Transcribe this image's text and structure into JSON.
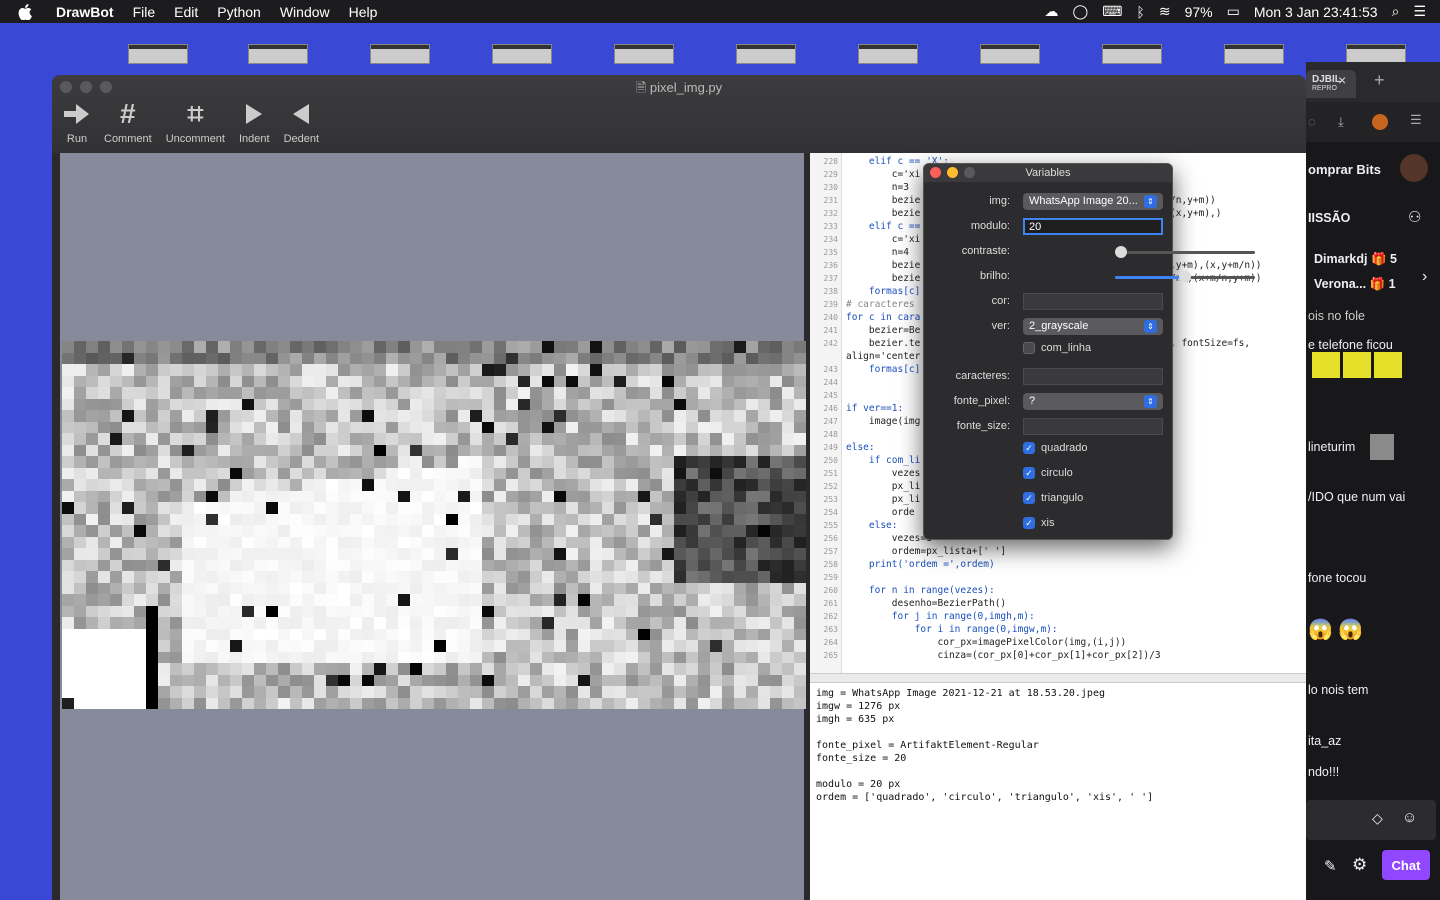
{
  "menubar": {
    "app": "DrawBot",
    "items": [
      "File",
      "Edit",
      "Python",
      "Window",
      "Help"
    ],
    "battery": "97%",
    "clock": "Mon 3 Jan  23:41:53"
  },
  "window": {
    "title": "pixel_img.py",
    "toolbar": {
      "run": "Run",
      "comment": "Comment",
      "uncomment": "Uncomment",
      "indent": "Indent",
      "dedent": "Dedent"
    }
  },
  "code": {
    "lines": [
      {
        "n": "228",
        "t": "    elif c == 'X':"
      },
      {
        "n": "229",
        "t": "        c='xi"
      },
      {
        "n": "230",
        "t": "        n=3"
      },
      {
        "n": "231",
        "t": "        bezie"
      },
      {
        "n": "232",
        "t": "        bezie"
      },
      {
        "n": "233",
        "t": "    elif c =="
      },
      {
        "n": "234",
        "t": "        c='xi"
      },
      {
        "n": "235",
        "t": "        n=4"
      },
      {
        "n": "236",
        "t": "        bezie"
      },
      {
        "n": "237",
        "t": "        bezie"
      },
      {
        "n": "238",
        "t": "    formas[c]"
      },
      {
        "n": "239",
        "t": "# caracteres"
      },
      {
        "n": "240",
        "t": "for c in cara"
      },
      {
        "n": "241",
        "t": "    bezier=Be"
      },
      {
        "n": "242",
        "t": "    bezier.te"
      },
      {
        "n": "",
        "t": "align='center"
      },
      {
        "n": "243",
        "t": "    formas[c]"
      },
      {
        "n": "244",
        "t": ""
      },
      {
        "n": "245",
        "t": ""
      },
      {
        "n": "246",
        "t": "if ver==1:"
      },
      {
        "n": "247",
        "t": "    image(img"
      },
      {
        "n": "248",
        "t": ""
      },
      {
        "n": "249",
        "t": "else:"
      },
      {
        "n": "250",
        "t": "    if com_li"
      },
      {
        "n": "251",
        "t": "        vezes"
      },
      {
        "n": "252",
        "t": "        px_li"
      },
      {
        "n": "253",
        "t": "        px_li"
      },
      {
        "n": "254",
        "t": "        orde"
      },
      {
        "n": "255",
        "t": "    else:"
      },
      {
        "n": "256",
        "t": "        vezes=1"
      },
      {
        "n": "257",
        "t": "        ordem=px_lista+[' ']"
      },
      {
        "n": "258",
        "t": "    print('ordem =',ordem)"
      },
      {
        "n": "259",
        "t": ""
      },
      {
        "n": "260",
        "t": "    for n in range(vezes):"
      },
      {
        "n": "261",
        "t": "        desenho=BezierPath()"
      },
      {
        "n": "262",
        "t": "        for j in range(0,imgh,m):"
      },
      {
        "n": "263",
        "t": "            for i in range(0,imgw,m):"
      },
      {
        "n": "264",
        "t": "                cor_px=imagePixelColor(img,(i,j))"
      },
      {
        "n": "265",
        "t": "                cinza=(cor_px[0]+cor_px[1]+cor_px[2])/3"
      }
    ],
    "right_fragments": [
      "/n,y+m))",
      "(x,y+m),)",
      ",y+m),(x,y+m/n))",
      "/n),(x+m/n,y+m))",
      ", fontSize=fs,"
    ]
  },
  "output": "img = WhatsApp Image 2021-12-21 at 18.53.20.jpeg\nimgw = 1276 px\nimgh = 635 px\n\nfonte_pixel = ArtifaktElement-Regular\nfonte_size = 20\n\nmodulo = 20 px\nordem = ['quadrado', 'circulo', 'triangulo', 'xis', ' ']",
  "variables": {
    "title": "Variables",
    "img_label": "img:",
    "img_value": "WhatsApp Image 20...",
    "modulo_label": "modulo:",
    "modulo_value": "20",
    "contraste_label": "contraste:",
    "contraste_level": 0.0,
    "brilho_label": "brilho:",
    "brilho_level": 0.5,
    "cor_label": "cor:",
    "ver_label": "ver:",
    "ver_value": "2_grayscale",
    "com_linha_label": "com_linha",
    "caracteres_label": "caracteres:",
    "fonte_pixel_label": "fonte_pixel:",
    "fonte_pixel_value": "?",
    "fonte_size_label": "fonte_size:",
    "quadrado": "quadrado",
    "circulo": "circulo",
    "triangulo": "triangulo",
    "xis": "xis"
  },
  "twitch": {
    "tab_title": "DJBIL",
    "tab_sub": "REPRO",
    "bits": "omprar Bits",
    "mission": "IISSÃO",
    "user1": "Dimarkdj",
    "user1_count": "5",
    "user2": "Verona...",
    "user2_count": "1",
    "msgs": [
      "ois no fole",
      "e telefone ficou",
      "lineturim",
      "/IDO que num vai",
      "fone tocou",
      "lo nois tem",
      "ita_az",
      "ndo!!!"
    ],
    "chat_button": "Chat"
  }
}
